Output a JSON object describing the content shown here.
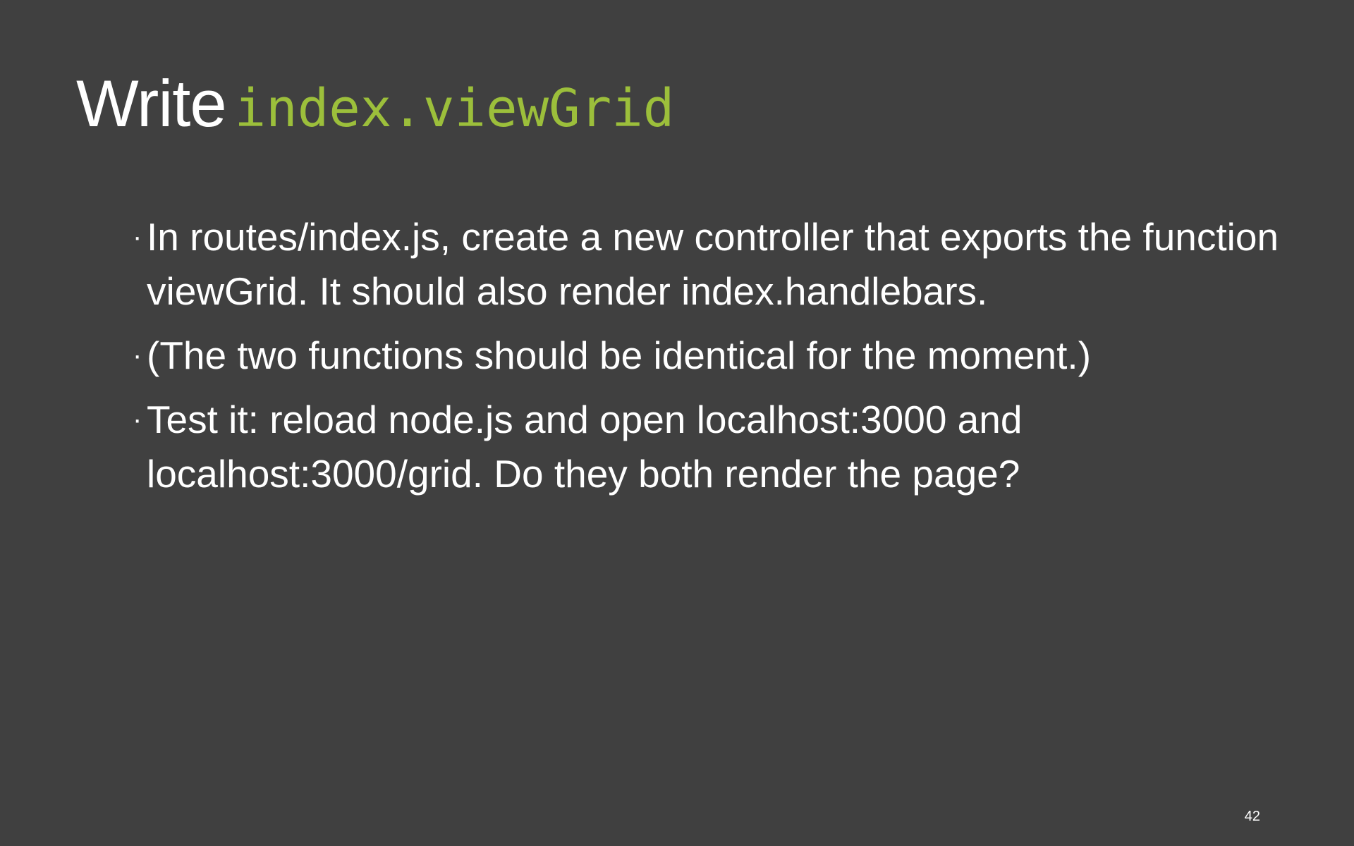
{
  "slide": {
    "title_word": "Write",
    "title_code": "index.viewGrid",
    "bullets": [
      {
        "text": "In routes/index.js, create a new controller that exports the function viewGrid. It should also render index.handlebars."
      },
      {
        "text": "(The two functions should be identical for the moment.)"
      },
      {
        "text": "Test it: reload node.js and open localhost:3000 and localhost:3000/grid. Do they both render the page?"
      }
    ],
    "bullet_marker": "·",
    "page_number": "42"
  },
  "colors": {
    "background": "#404040",
    "text": "#ffffff",
    "code_accent": "#9cbf3b"
  }
}
